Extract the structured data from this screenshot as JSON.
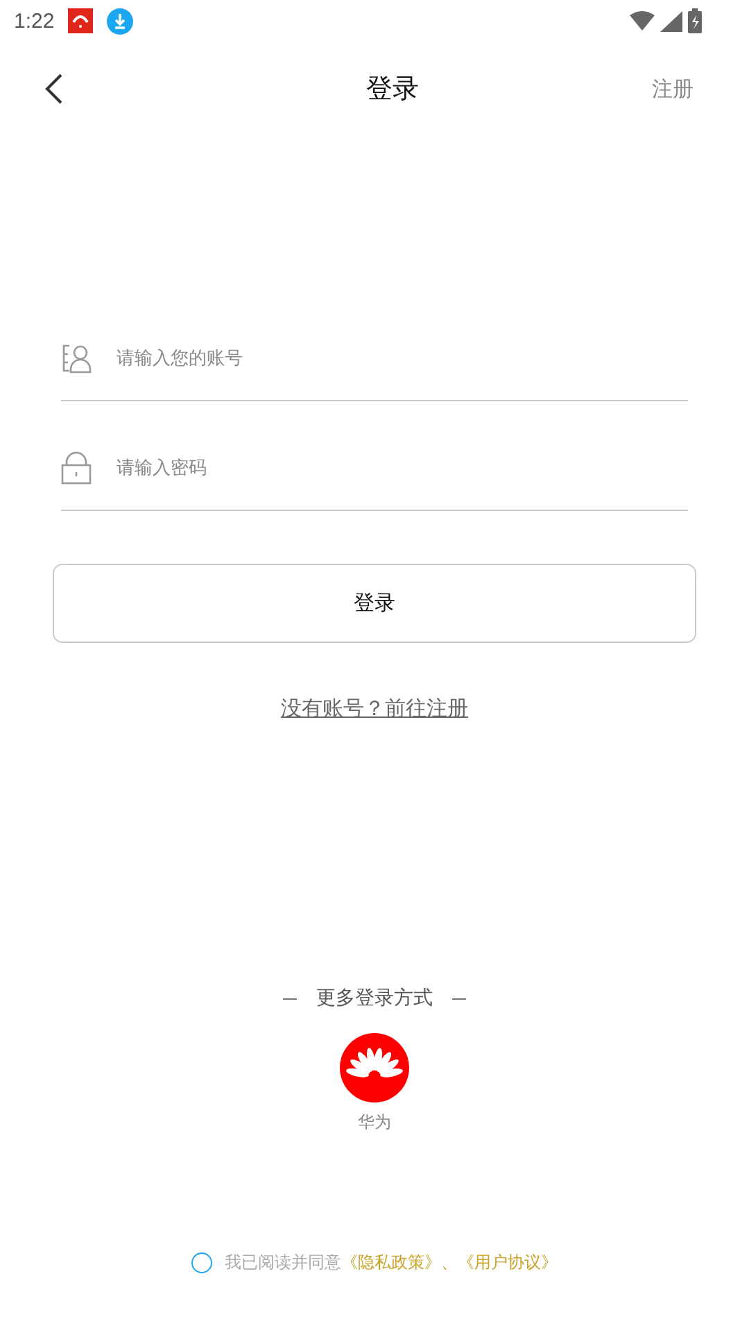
{
  "status_bar": {
    "time": "1:22"
  },
  "header": {
    "title": "登录",
    "action": "注册"
  },
  "fields": [
    {
      "kind": "account",
      "placeholder": "请输入您的账号"
    },
    {
      "kind": "password",
      "placeholder": "请输入密码"
    }
  ],
  "login_button": "登录",
  "register_link": "没有账号？前往注册",
  "more_login": {
    "title": "更多登录方式",
    "providers": [
      {
        "label": "华为"
      }
    ]
  },
  "agreement": {
    "checked": false,
    "text": "我已阅读并同意",
    "privacy": "《隐私政策》",
    "separator": "、",
    "terms": "《用户协议》"
  }
}
